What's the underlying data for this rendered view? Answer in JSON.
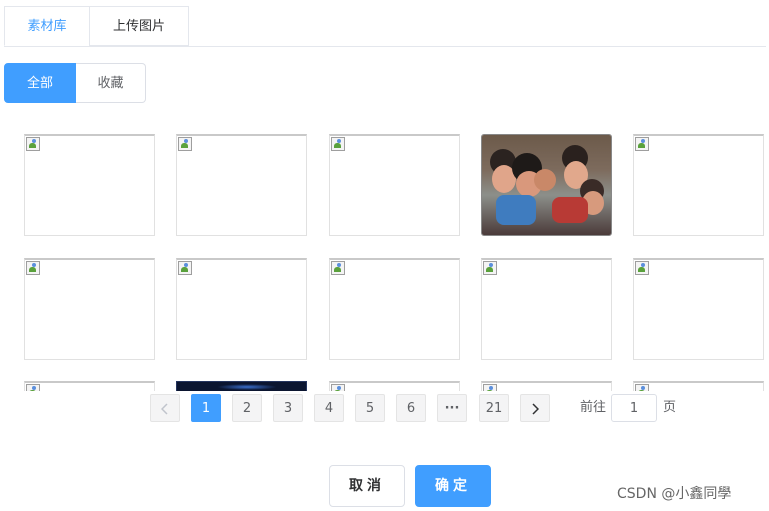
{
  "tabs": [
    {
      "label": "素材库",
      "active": true
    },
    {
      "label": "上传图片",
      "active": false
    }
  ],
  "filters": [
    {
      "label": "全部",
      "active": true
    },
    {
      "label": "收藏",
      "active": false
    }
  ],
  "grid": {
    "tiles": [
      {
        "type": "broken-image"
      },
      {
        "type": "broken-image"
      },
      {
        "type": "broken-image"
      },
      {
        "type": "photo"
      },
      {
        "type": "broken-image"
      },
      {
        "type": "broken-image"
      },
      {
        "type": "broken-image"
      },
      {
        "type": "broken-image"
      },
      {
        "type": "broken-image"
      },
      {
        "type": "broken-image"
      },
      {
        "type": "broken-image"
      },
      {
        "type": "dark-image"
      },
      {
        "type": "broken-image"
      },
      {
        "type": "broken-image"
      },
      {
        "type": "broken-image"
      }
    ]
  },
  "pagination": {
    "prev_icon": "chevron-left-icon",
    "next_icon": "chevron-right-icon",
    "pages": [
      "1",
      "2",
      "3",
      "4",
      "5",
      "6"
    ],
    "ellipsis": "···",
    "last_page": "21",
    "current_page": "1",
    "goto_label": "前往",
    "goto_value": "1",
    "goto_unit": "页"
  },
  "actions": {
    "cancel_label": "取消",
    "confirm_label": "确定"
  },
  "watermark": "CSDN @小鑫同學",
  "colors": {
    "primary": "#409eff",
    "border": "#dcdfe6",
    "text": "#303133"
  }
}
